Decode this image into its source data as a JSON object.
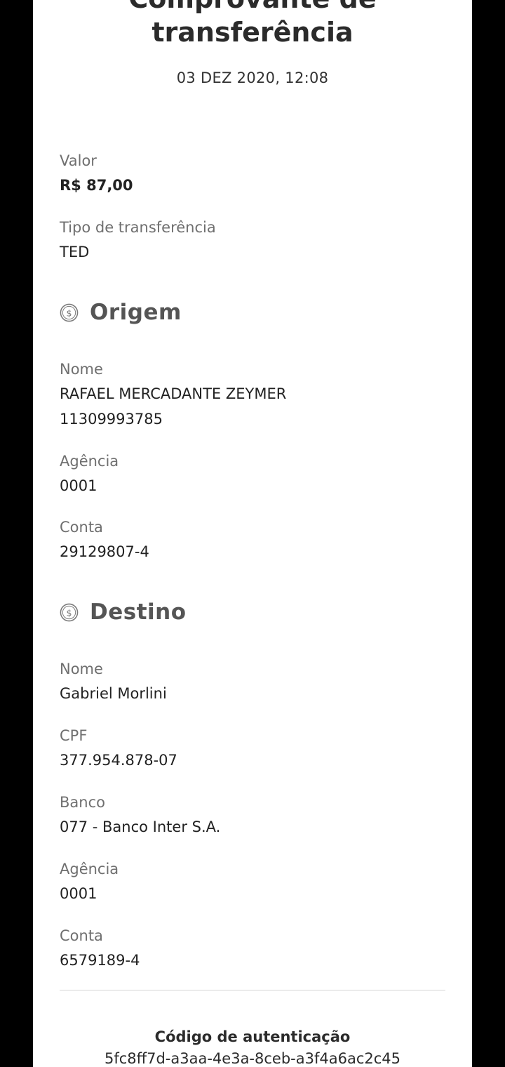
{
  "header": {
    "title_line1": "Comprovante de",
    "title_line2": "transferência",
    "date": "03 DEZ 2020, 12:08"
  },
  "summary": {
    "valor_label": "Valor",
    "valor_value": "R$ 87,00",
    "tipo_label": "Tipo de transferência",
    "tipo_value": "TED"
  },
  "origem": {
    "title": "Origem",
    "icon": "dollar-coin-icon",
    "nome_label": "Nome",
    "nome_value": "RAFAEL MERCADANTE ZEYMER",
    "documento_value": "11309993785",
    "agencia_label": "Agência",
    "agencia_value": "0001",
    "conta_label": "Conta",
    "conta_value": "29129807-4"
  },
  "destino": {
    "title": "Destino",
    "icon": "dollar-coin-icon",
    "nome_label": "Nome",
    "nome_value": "Gabriel Morlini",
    "cpf_label": "CPF",
    "cpf_value": "377.954.878-07",
    "banco_label": "Banco",
    "banco_value": "077 - Banco Inter S.A.",
    "agencia_label": "Agência",
    "agencia_value": "0001",
    "conta_label": "Conta",
    "conta_value": "6579189-4"
  },
  "authentication": {
    "label": "Código de autenticação",
    "code": "5fc8ff7d-a3aa-4e3a-8ceb-a3f4a6ac2c45"
  },
  "colors": {
    "background_outer": "#000000",
    "page": "#ffffff",
    "label": "#6f6f6f",
    "text": "#222222",
    "section_title": "#555555"
  }
}
